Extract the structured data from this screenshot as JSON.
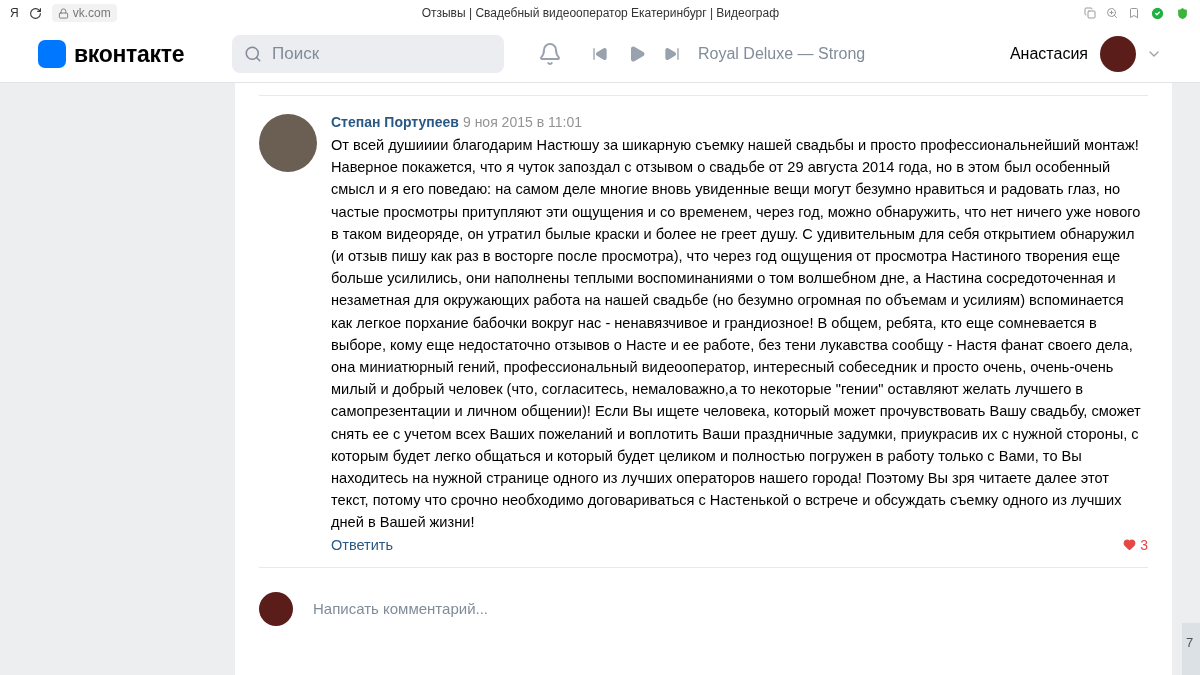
{
  "browser": {
    "logo": "Я",
    "address": "vk.com",
    "title": "Отзывы | Свадебный видеооператор Екатеринбург | Видеограф"
  },
  "header": {
    "brand": "вконтакте",
    "search": {
      "placeholder": "Поиск"
    },
    "track": "Royal Deluxe — Strong",
    "user": "Анастасия"
  },
  "comment": {
    "author": "Степан Портупеев",
    "date": "9 ноя 2015 в 11:01",
    "text": "От всей душииии благодарим Настюшу за шикарную съемку нашей свадьбы и просто профессиональнейший монтаж! Наверное покажется, что я чуток запоздал с отзывом о свадьбе от 29 августа 2014 года, но в этом был особенный смысл и я его поведаю: на самом деле многие вновь увиденные вещи могут безумно нравиться и радовать глаз, но частые просмотры притупляют эти ощущения и со временем, через год, можно обнаружить, что нет ничего уже нового в таком видеоряде, он утратил былые краски и более не греет душу. С удивительным для себя открытием обнаружил (и отзыв пишу как раз в восторге после просмотра), что через год ощущения от просмотра Настиного творения еще больше усилились, они наполнены теплыми воспоминаниями о том волшебном дне, а Настина сосредоточенная и незаметная для окружающих работа на нашей свадьбе (но безумно огромная по объемам и усилиям) вспоминается как легкое порхание бабочки вокруг нас - ненавязчивое и грандиозное! В общем, ребята, кто еще сомневается в выборе, кому еще недостаточно отзывов о Насте и ее работе, без тени лукавства сообщу - Настя фанат своего дела, она миниатюрный гений, профессиональный видеооператор, интересный собеседник и просто очень, очень-очень милый и добрый человек (что, согласитесь, немаловажно,а то некоторые \"гении\" оставляют желать лучшего в самопрезентации и личном общении)! Если Вы ищете человека, который может прочувствовать Вашу свадьбу, сможет снять ее с учетом всех Ваших пожеланий и воплотить Ваши праздничные задумки, приукрасив их с нужной стороны, с которым будет легко общаться и который будет целиком и полностью погружен в работу только с Вами, то Вы находитесь на нужной странице одного из лучших операторов нашего города! Поэтому Вы зря читаете далее этот текст, потому что срочно необходимо договариваться с Настенькой о встрече и обсуждать съемку одного из лучших дней в Вашей жизни!",
    "reply": "Ответить",
    "liked": true,
    "likes": "3"
  },
  "composer": {
    "placeholder": "Написать комментарий..."
  },
  "side_tab": "7"
}
